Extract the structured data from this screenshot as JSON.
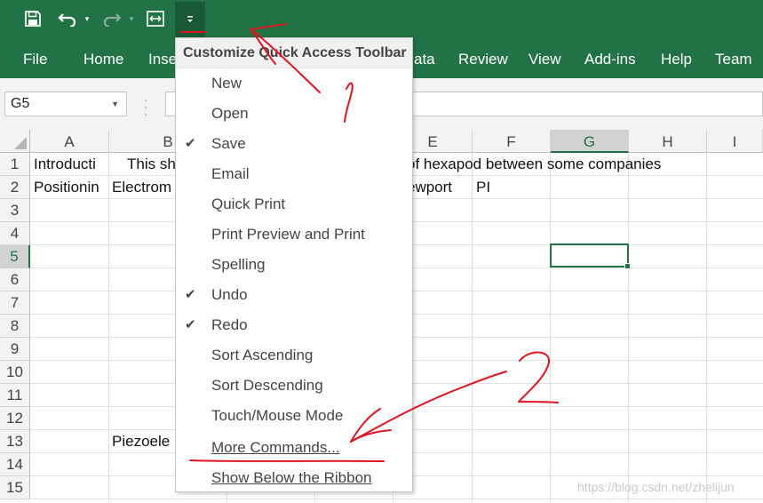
{
  "qat": {
    "icons": [
      "save-icon",
      "undo-icon",
      "redo-icon",
      "touch-mouse-mode-icon",
      "customize-qat-icon"
    ]
  },
  "ribbon": {
    "tabs": [
      "File",
      "Home",
      "Inse",
      "ata",
      "Review",
      "View",
      "Add-ins",
      "Help",
      "Team"
    ]
  },
  "formula_bar": {
    "name_box": "G5"
  },
  "columns": [
    "A",
    "B",
    "",
    "",
    "E",
    "F",
    "G",
    "H",
    "I"
  ],
  "rows": [
    "1",
    "2",
    "3",
    "4",
    "5",
    "6",
    "7",
    "8",
    "9",
    "10",
    "11",
    "12",
    "13",
    "14",
    "15"
  ],
  "cells": {
    "A1": "Introducti",
    "B1": "This sh",
    "E1": "of hexapod between some companies",
    "A2": "Positionin",
    "B2": "Electrom",
    "E2": "ewport",
    "F2": "PI",
    "B13": "Piezoele"
  },
  "menu": {
    "title": "Customize Quick Access Toolbar",
    "items": [
      {
        "label": "New",
        "checked": false
      },
      {
        "label": "Open",
        "checked": false
      },
      {
        "label": "Save",
        "checked": true
      },
      {
        "label": "Email",
        "checked": false
      },
      {
        "label": "Quick Print",
        "checked": false
      },
      {
        "label": "Print Preview and Print",
        "checked": false
      },
      {
        "label": "Spelling",
        "checked": false
      },
      {
        "label": "Undo",
        "checked": true
      },
      {
        "label": "Redo",
        "checked": true
      },
      {
        "label": "Sort Ascending",
        "checked": false
      },
      {
        "label": "Sort Descending",
        "checked": false
      },
      {
        "label": "Touch/Mouse Mode",
        "checked": false
      },
      {
        "label": "More Commands...",
        "checked": false
      },
      {
        "label": "Show Below the Ribbon",
        "checked": false
      }
    ]
  },
  "annotations": {
    "label_1": "1",
    "label_2": "2",
    "color": "#e0141e"
  },
  "watermark": "https://blog.csdn.net/zhelijun",
  "colors": {
    "excel_green": "#217346",
    "menu_bg": "#ffffff",
    "grid_line": "#e1e1e1"
  }
}
